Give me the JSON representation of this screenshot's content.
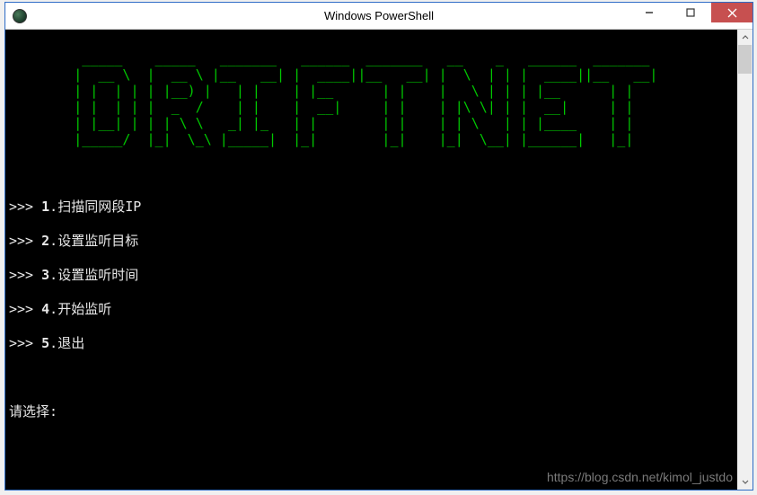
{
  "window": {
    "title": "Windows PowerShell"
  },
  "ascii_art": "         _____    _____   _______   ______  _______   __    _   ______  _______\n        |  __ \\  |  __ \\ |__   __| |  ____||__   __| |  \\  | | |  ____||__   __|\n        | |  | | | |__) |   | |    | |__      | |    |   \\ | | | |__      | |\n        | |  | | |  _  /    | |    |  __|     | |    | |\\ \\| | |  __|     | |\n        | |__| | | | \\ \\   _| |_   | |        | |    | | \\   | | |____    | |\n        |_____/  |_|  \\_\\ |_____|  |_|        |_|    |_|  \\__| |______|   |_|",
  "menu": {
    "prefix": ">>> ",
    "items": [
      {
        "num": "1",
        "label": "扫描同网段IP"
      },
      {
        "num": "2",
        "label": "设置监听目标"
      },
      {
        "num": "3",
        "label": "设置监听时间"
      },
      {
        "num": "4",
        "label": "开始监听"
      },
      {
        "num": "5",
        "label": "退出"
      }
    ],
    "prompt": "请选择: "
  },
  "watermark": "https://blog.csdn.net/kimol_justdo"
}
